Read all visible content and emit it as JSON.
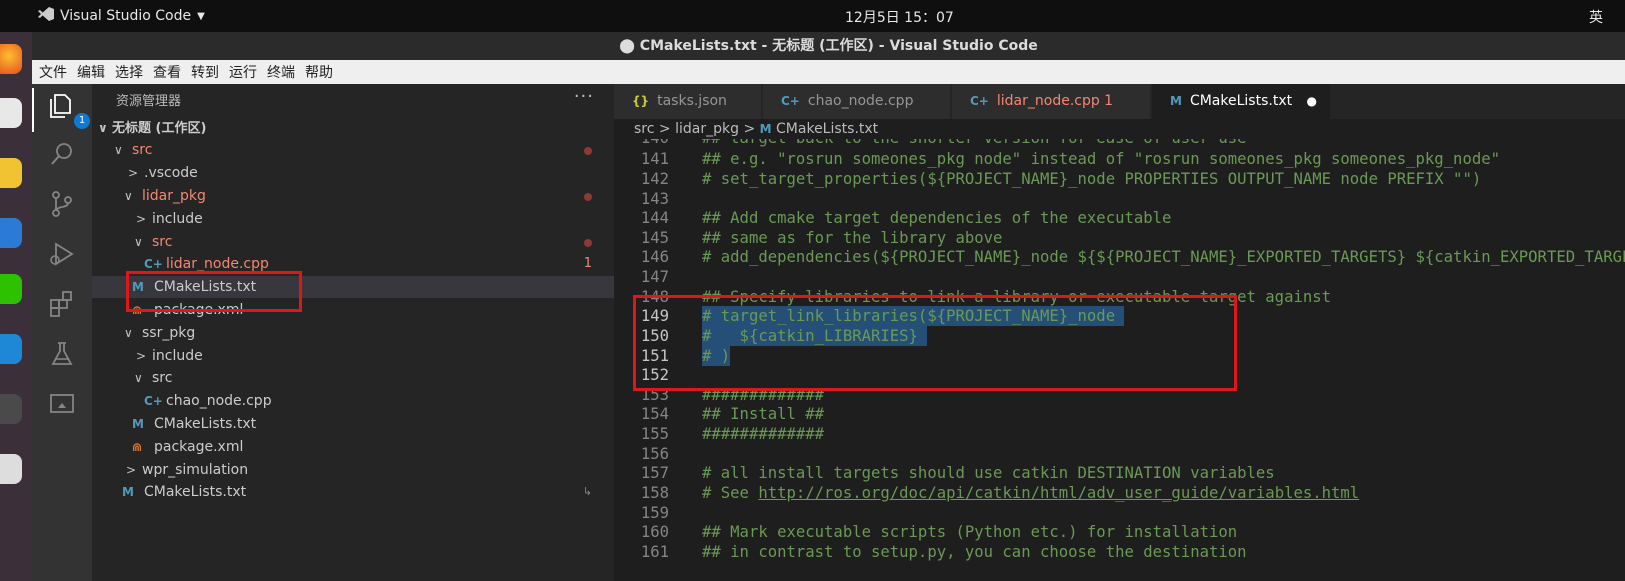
{
  "topbar": {
    "app_name": "Visual Studio Code",
    "clock": "12月5日  15：07",
    "ime": "英"
  },
  "window": {
    "title": "⬤ CMakeLists.txt - 无标题 (工作区) - Visual Studio Code"
  },
  "menu": [
    "文件",
    "编辑",
    "选择",
    "查看",
    "转到",
    "运行",
    "终端",
    "帮助"
  ],
  "activity": {
    "explorer_badge": "1"
  },
  "explorer": {
    "header": "资源管理器",
    "more": "···",
    "rows": [
      {
        "label": "无标题 (工作区)",
        "chev": "∨"
      },
      {
        "label": "src",
        "chev": "∨"
      },
      {
        "label": ".vscode",
        "chev": ">"
      },
      {
        "label": "lidar_pkg",
        "chev": "∨"
      },
      {
        "label": "include",
        "chev": ">"
      },
      {
        "label": "src",
        "chev": "∨"
      },
      {
        "label": "lidar_node.cpp",
        "icon": "C+",
        "badge": "1"
      },
      {
        "label": "CMakeLists.txt",
        "icon": "M"
      },
      {
        "label": "package.xml",
        "icon": "⋒"
      },
      {
        "label": "ssr_pkg",
        "chev": "∨"
      },
      {
        "label": "include",
        "chev": ">"
      },
      {
        "label": "src",
        "chev": "∨"
      },
      {
        "label": "chao_node.cpp",
        "icon": "C+"
      },
      {
        "label": "CMakeLists.txt",
        "icon": "M"
      },
      {
        "label": "package.xml",
        "icon": "⋒"
      },
      {
        "label": "wpr_simulation",
        "chev": ">"
      },
      {
        "label": "CMakeLists.txt",
        "icon": "M",
        "badge": "↳"
      }
    ]
  },
  "tabs": [
    {
      "label": "tasks.json",
      "icon": "{}"
    },
    {
      "label": "chao_node.cpp",
      "icon": "C+"
    },
    {
      "label": "lidar_node.cpp 1",
      "icon": "C+"
    },
    {
      "label": "CMakeLists.txt",
      "icon": "M",
      "dirty": "●"
    }
  ],
  "breadcrumb": [
    "src",
    ">",
    "lidar_pkg",
    ">",
    "M",
    "CMakeLists.txt"
  ],
  "code": [
    {
      "n": "140",
      "t": "## target back to the shorter version for ease of user use"
    },
    {
      "n": "141",
      "t": "## e.g. \"rosrun someones_pkg node\" instead of \"rosrun someones_pkg someones_pkg_node\""
    },
    {
      "n": "142",
      "t": "# set_target_properties(${PROJECT_NAME}_node PROPERTIES OUTPUT_NAME node PREFIX \"\")"
    },
    {
      "n": "143",
      "t": ""
    },
    {
      "n": "144",
      "t": "## Add cmake target dependencies of the executable"
    },
    {
      "n": "145",
      "t": "## same as for the library above"
    },
    {
      "n": "146",
      "t": "# add_dependencies(${PROJECT_NAME}_node ${${PROJECT_NAME}_EXPORTED_TARGETS} ${catkin_EXPORTED_TARGETS})"
    },
    {
      "n": "147",
      "t": ""
    },
    {
      "n": "148",
      "t": "## Specify libraries to link a library or executable target against"
    },
    {
      "n": "149",
      "t": "# target_link_libraries(${PROJECT_NAME}_node "
    },
    {
      "n": "150",
      "t": "#   ${catkin_LIBRARIES} "
    },
    {
      "n": "151",
      "t": "# )"
    },
    {
      "n": "152",
      "t": ""
    },
    {
      "n": "153",
      "t": "#############"
    },
    {
      "n": "154",
      "t": "## Install ##"
    },
    {
      "n": "155",
      "t": "#############"
    },
    {
      "n": "156",
      "t": ""
    },
    {
      "n": "157",
      "t": "# all install targets should use catkin DESTINATION variables"
    },
    {
      "n": "158",
      "t": "# See ",
      "link": "http://ros.org/doc/api/catkin/html/adv_user_guide/variables.html"
    },
    {
      "n": "159",
      "t": ""
    },
    {
      "n": "160",
      "t": "## Mark executable scripts (Python etc.) for installation"
    },
    {
      "n": "161",
      "t": "## in contrast to setup.py, you can choose the destination"
    }
  ],
  "colors": {
    "comment": "#6a9955",
    "selection": "#264f78",
    "annotation": "#e0161c",
    "error": "#f48771"
  }
}
